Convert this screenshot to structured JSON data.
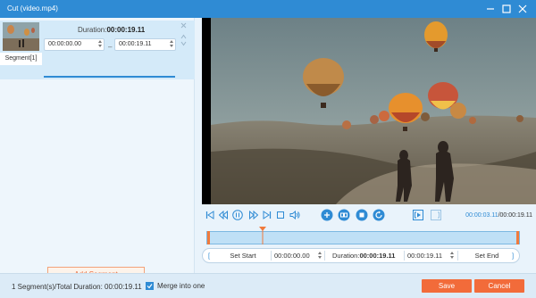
{
  "window": {
    "title": "Cut (video.mp4)",
    "controls": {
      "minimize": "minimize-icon",
      "maximize": "maximize-icon",
      "close": "close-icon"
    }
  },
  "segment": {
    "tab_label": "Segment[1]",
    "duration_label": "Duration:",
    "duration_value": "00:00:19.11",
    "start": "00:00:00.00",
    "separator": "–",
    "end": "00:00:19.11",
    "progress": 1.0
  },
  "left_panel": {
    "add_segment_label": "Add Segment"
  },
  "player": {
    "controls": [
      "skip-start-icon",
      "rewind-icon",
      "pause-icon",
      "fast-forward-icon",
      "skip-end-icon",
      "stop-icon",
      "volume-icon",
      "add-segment-icon",
      "copy-segment-icon",
      "split-icon",
      "reset-icon",
      "set-start-bracket-icon",
      "set-end-bracket-icon"
    ],
    "current_time": "00:00:03.11",
    "total_time": "/00:00:19.11"
  },
  "timeline": {
    "playhead_fraction": 0.18
  },
  "edit_row": {
    "set_start_label": "Set Start",
    "start_value": "00:00:00.00",
    "duration_label": "Duration:",
    "duration_value": "00:00:19.11",
    "end_value": "00:00:19.11",
    "set_end_label": "Set End"
  },
  "footer": {
    "summary": "1 Segment(s)/Total Duration: 00:00:19.11",
    "merge_label": "Merge into one",
    "merge_checked": true,
    "save_label": "Save",
    "cancel_label": "Cancel"
  },
  "colors": {
    "accent": "#2f8bd4",
    "orange": "#f26b3a",
    "panel": "#eef6fc"
  }
}
